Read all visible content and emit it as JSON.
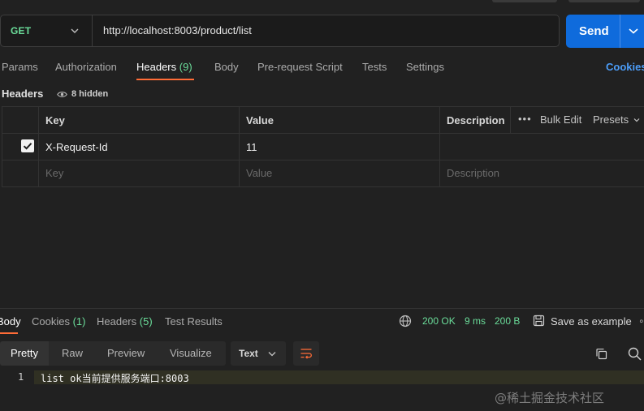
{
  "request": {
    "method": "GET",
    "url": "http://localhost:8003/product/list",
    "send_label": "Send"
  },
  "request_tabs": [
    {
      "label": "Params"
    },
    {
      "label": "Authorization"
    },
    {
      "label": "Headers",
      "count": "(9)"
    },
    {
      "label": "Body"
    },
    {
      "label": "Pre-request Script"
    },
    {
      "label": "Tests"
    },
    {
      "label": "Settings"
    }
  ],
  "cookies_label": "Cookies",
  "headers_section": {
    "title": "Headers",
    "hidden_label": "8 hidden"
  },
  "headers_table": {
    "columns": {
      "key": "Key",
      "value": "Value",
      "description": "Description"
    },
    "tools": {
      "bulk_edit": "Bulk Edit",
      "presets": "Presets"
    },
    "rows": [
      {
        "checked": true,
        "key": "X-Request-Id",
        "value": "11",
        "description": ""
      }
    ],
    "placeholders": {
      "key": "Key",
      "value": "Value",
      "description": "Description"
    }
  },
  "response": {
    "tabs": [
      {
        "label": "Body"
      },
      {
        "label": "Cookies",
        "count": "(1)"
      },
      {
        "label": "Headers",
        "count": "(5)"
      },
      {
        "label": "Test Results"
      }
    ],
    "status": "200 OK",
    "time": "9 ms",
    "size": "200 B",
    "save_label": "Save as example",
    "view_tabs": [
      "Pretty",
      "Raw",
      "Preview",
      "Visualize"
    ],
    "format": "Text",
    "lines": [
      {
        "number": "1",
        "text": "list ok当前提供服务端口:8003"
      }
    ]
  },
  "watermark": "@稀土掘金技术社区",
  "colors": {
    "accent": "#ff6c37",
    "send": "#0f6bdc",
    "method": "#6bdd9a",
    "link": "#4c9df8"
  }
}
